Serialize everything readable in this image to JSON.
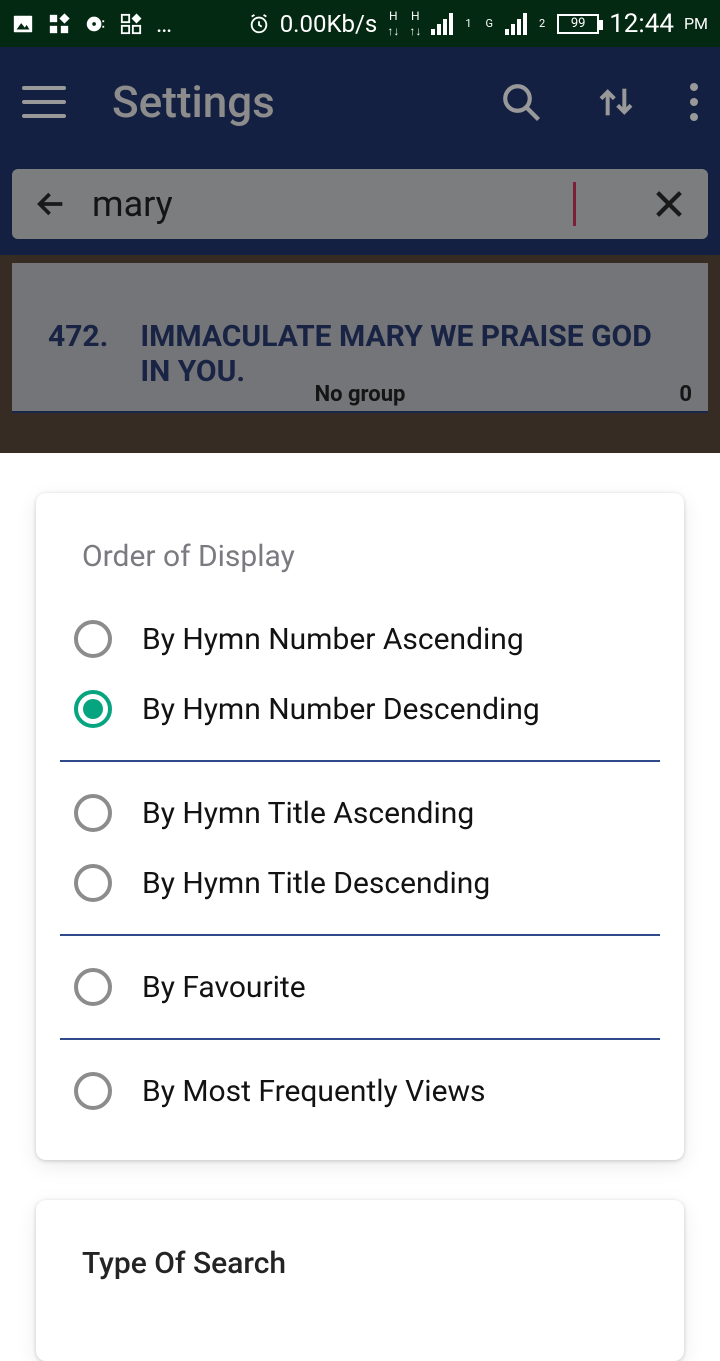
{
  "status": {
    "net_speed": "0.00Kb/s",
    "net1_label": "H",
    "net2_label": "H",
    "sig1_sub": "1",
    "sig2_top": "G",
    "sig2_sub": "2",
    "battery": "99",
    "time": "12:44",
    "ampm": "PM"
  },
  "appbar": {
    "title": "Settings"
  },
  "search": {
    "value": "mary"
  },
  "result": {
    "number": "472.",
    "title": "IMMACULATE MARY WE PRAISE GOD IN YOU.",
    "group": "No group",
    "count": "0"
  },
  "sheet": {
    "order_title": "Order of Display",
    "opts": {
      "o1": "By Hymn Number Ascending",
      "o2": "By Hymn Number Descending",
      "o3": "By Hymn Title Ascending",
      "o4": "By Hymn Title Descending",
      "o5": "By Favourite",
      "o6": "By Most Frequently Views"
    },
    "search_type_title": "Type Of Search"
  }
}
